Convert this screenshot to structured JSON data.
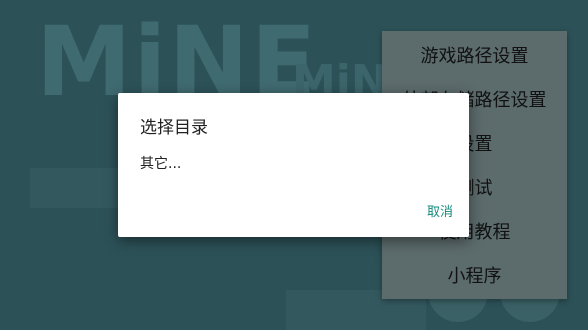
{
  "background": {
    "logo_text": "MiNE",
    "sublogo_text": "MiN"
  },
  "overflow_menu": {
    "items": [
      {
        "label": "游戏路径设置"
      },
      {
        "label": "外部存储路径设置"
      },
      {
        "label": "设置"
      },
      {
        "label": "测试"
      },
      {
        "label": "使用教程"
      },
      {
        "label": "小程序"
      }
    ]
  },
  "dialog": {
    "title": "选择目录",
    "items": [
      {
        "label": "其它..."
      }
    ],
    "cancel_label": "取消"
  },
  "colors": {
    "accent": "#128a7e",
    "dialog_bg": "#ffffff",
    "scrim_bg": "#2c5258"
  }
}
